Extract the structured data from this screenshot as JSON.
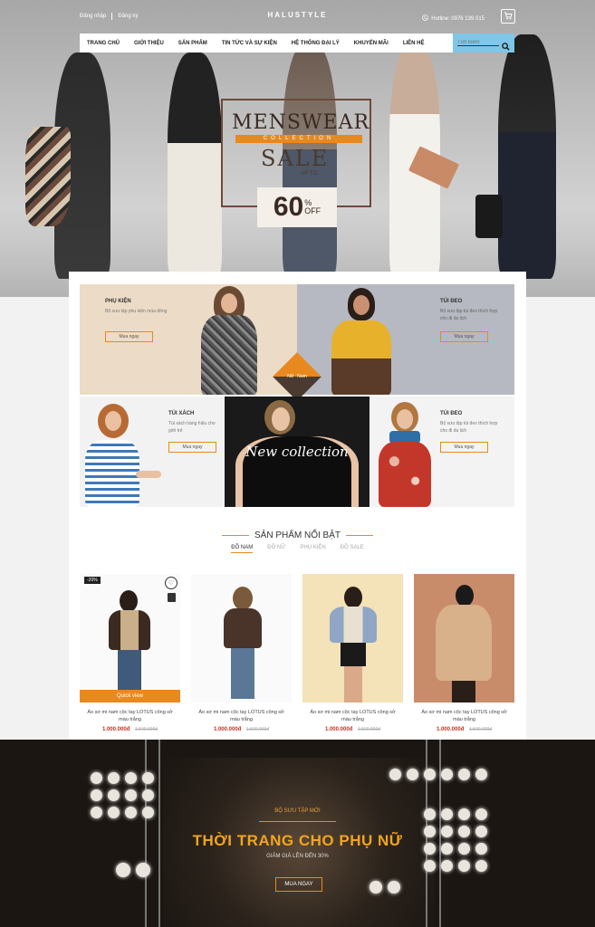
{
  "header": {
    "login": "Đăng nhập",
    "register": "Đăng ký",
    "logo": "HALUSTYLE",
    "hotline": "Hotline: 0976 139 015"
  },
  "nav": {
    "items": [
      "TRANG CHỦ",
      "GIỚI THIỆU",
      "SẢN PHẨM",
      "TIN TỨC VÀ SỰ KIỆN",
      "HỆ THỐNG ĐẠI LÝ",
      "KHUYẾN MÃI",
      "LIÊN HỆ"
    ],
    "search_placeholder": "Tìm kiếm"
  },
  "promo": {
    "line1": "MENSWEAR",
    "line2": "COLLECTION",
    "line3": "SALE",
    "line4": "UP TO",
    "percent": "60",
    "percent_sign": "%",
    "off": "OFF"
  },
  "banners": {
    "phukien": {
      "title": "PHỤ KIỆN",
      "desc": "Bộ sưu tập phụ kiện mùa đông",
      "button": "Mua ngay"
    },
    "tuideo1": {
      "title": "TÚI ĐEO",
      "desc": "Bộ sưu tập túi đeo thích hợp cho đi du lịch",
      "button": "Mua ngay"
    },
    "tuixach": {
      "title": "TÚI XÁCH",
      "desc": "Túi xách hàng hiệu cho giới trẻ",
      "button": "Mua ngay"
    },
    "newcollection": "New collection",
    "tuideo2": {
      "title": "TÚI ĐEO",
      "desc": "Bộ sưu tập túi đeo thích hợp cho đi du lịch",
      "button": "Mua ngay"
    },
    "gender_female": "Nữ",
    "gender_male": "Nam"
  },
  "featured": {
    "title": "SẢN PHẨM NỔI BẬT",
    "tabs": [
      "ĐỒ NAM",
      "ĐỒ NỮ",
      "PHỤ KIỆN",
      "ĐỒ SALE"
    ]
  },
  "products": [
    {
      "name": "Áo sơ mi nam cộc tay LOTUS công sở màu trắng",
      "price": "1.000.000đ",
      "old_price": "1.500.000đ",
      "badge": "-20%",
      "quick_view": "Quick view"
    },
    {
      "name": "Áo sơ mi nam cộc tay LOTUS công sở màu trắng",
      "price": "1.000.000đ",
      "old_price": "1.500.000đ"
    },
    {
      "name": "Áo sơ mi nam cộc tay LOTUS công sở màu trắng",
      "price": "1.000.000đ",
      "old_price": "1.500.000đ"
    },
    {
      "name": "Áo sơ mi nam cộc tay LOTUS công sở màu trắng",
      "price": "1.000.000đ",
      "old_price": "1.500.000đ"
    }
  ],
  "stage": {
    "tag": "BỘ SƯU TẬP MỚI",
    "headline": "THỜI TRANG CHO PHỤ NỮ",
    "sub": "GIẢM GIÁ LÊN ĐẾN 30%",
    "button": "MUA NGAY"
  },
  "colors": {
    "accent": "#e8891f",
    "price": "#c6311e",
    "search_bg": "#7fc6e8"
  }
}
